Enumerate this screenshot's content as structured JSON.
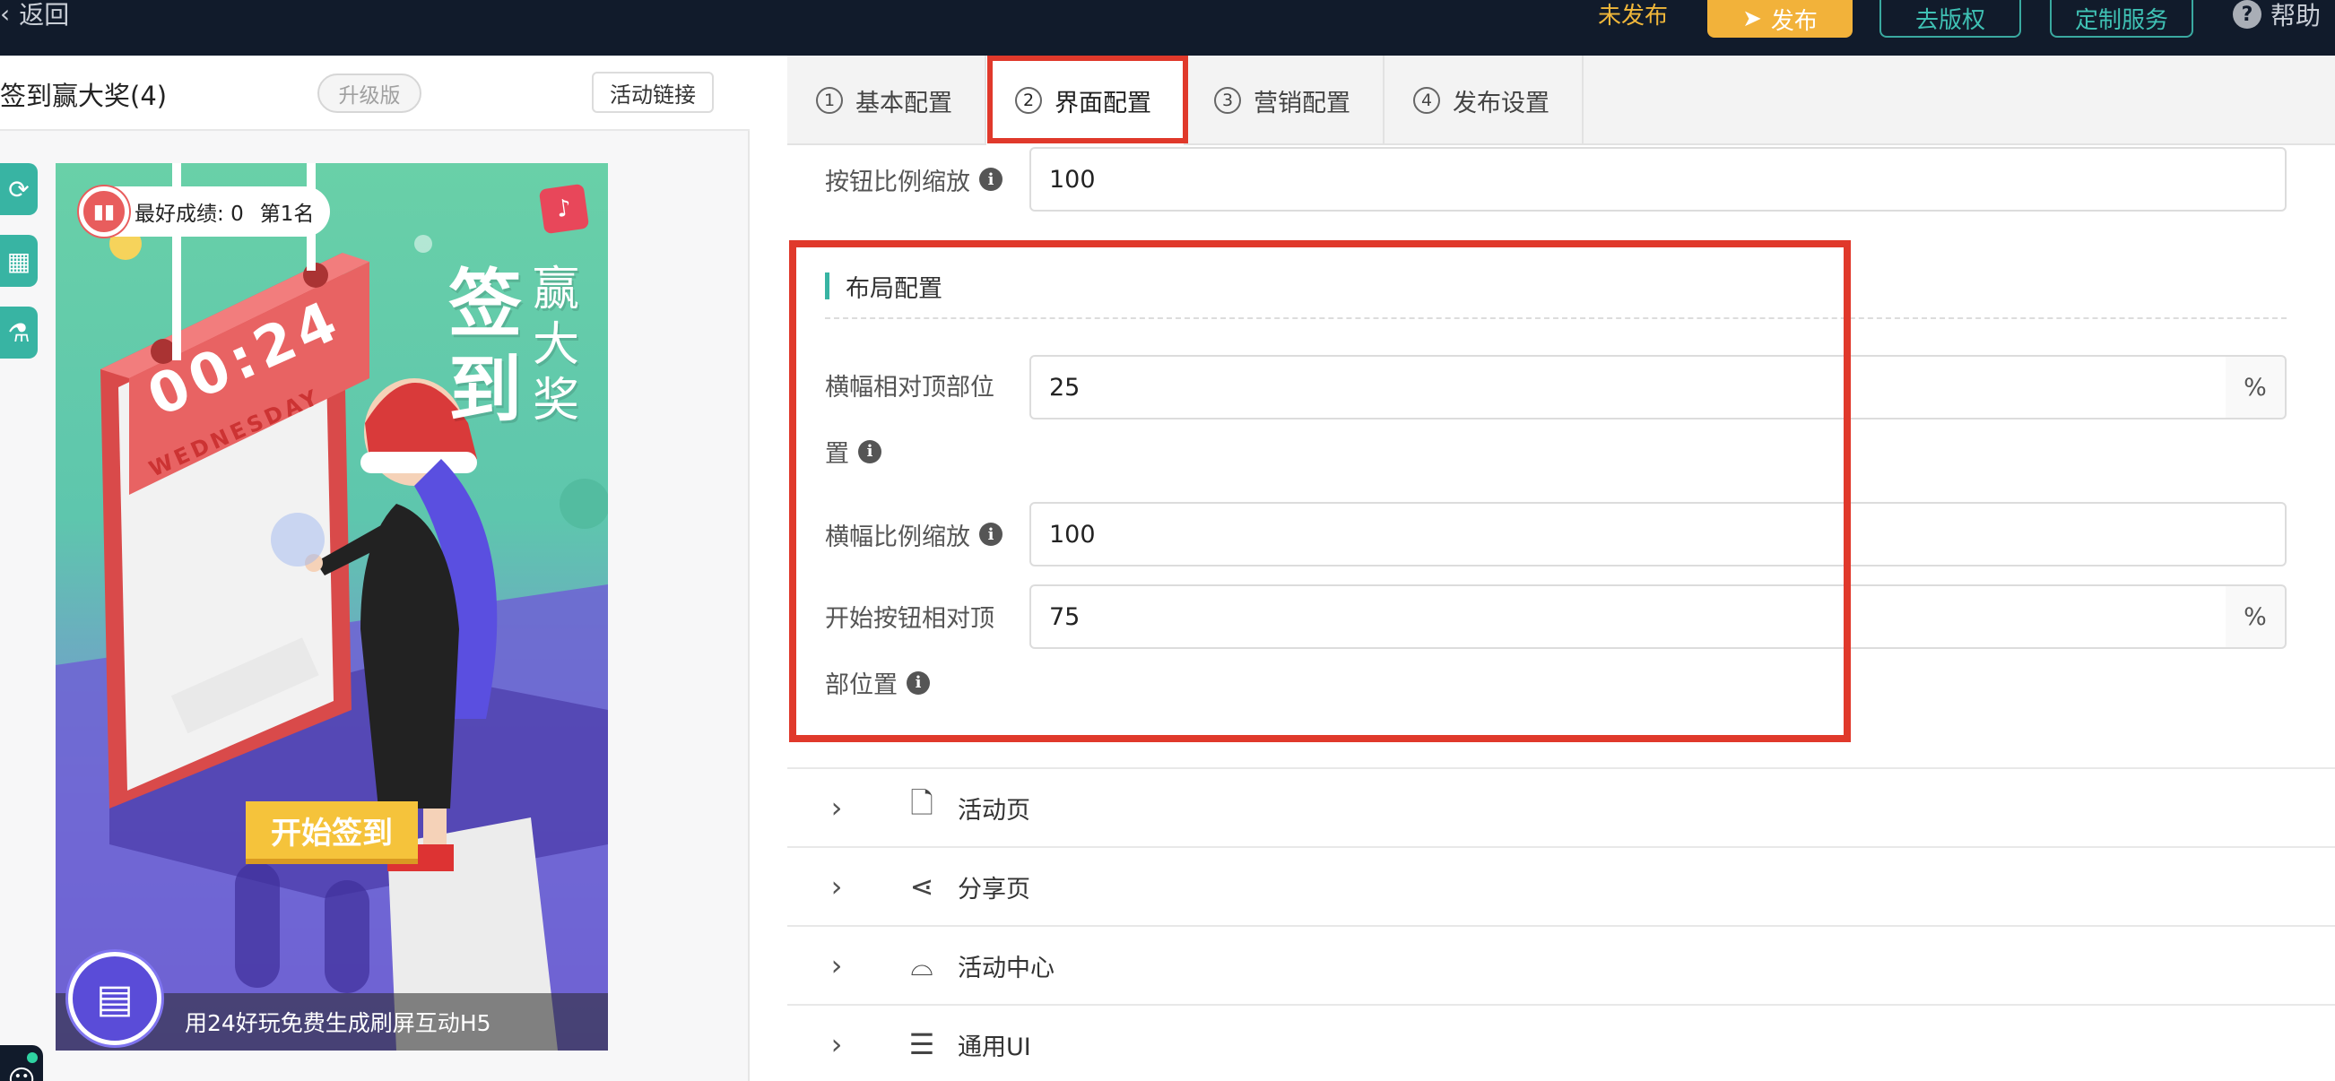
{
  "topbar": {
    "back_label": "返回",
    "status": "未发布",
    "publish_label": "发布",
    "license_label": "去版权",
    "custom_service_label": "定制服务",
    "help_label": "帮助"
  },
  "left_panel": {
    "activity_title": "签到赢大奖(4)",
    "badge": "升级版",
    "link_button": "活动链接"
  },
  "preview": {
    "score_label": "最好成绩:",
    "score_value": "0",
    "rank": "第1名",
    "title_big": "签到",
    "title_small": "赢大奖",
    "clock_time": "00:24",
    "clock_day": "WEDNESDAY",
    "start_button": "开始签到",
    "footer_text": "用24好玩免费生成刷屏互动H5"
  },
  "tabs": [
    {
      "num": "1",
      "label": "基本配置"
    },
    {
      "num": "2",
      "label": "界面配置"
    },
    {
      "num": "3",
      "label": "营销配置"
    },
    {
      "num": "4",
      "label": "发布设置"
    }
  ],
  "form": {
    "button_scale_label": "按钮比例缩放",
    "button_scale_value": "100",
    "section_title": "布局配置",
    "banner_top_label_1": "横幅相对顶部位",
    "banner_top_label_2": "置",
    "banner_top_value": "25",
    "banner_top_unit": "%",
    "banner_scale_label": "横幅比例缩放",
    "banner_scale_value": "100",
    "start_top_label_1": "开始按钮相对顶",
    "start_top_label_2": "部位置",
    "start_top_value": "75",
    "start_top_unit": "%"
  },
  "accordion": [
    {
      "label": "活动页",
      "icon": "page-icon"
    },
    {
      "label": "分享页",
      "icon": "share-icon"
    },
    {
      "label": "活动中心",
      "icon": "whistle-icon"
    },
    {
      "label": "通用UI",
      "icon": "sliders-icon"
    }
  ],
  "colors": {
    "topbar_bg": "#111b2b",
    "accent_teal": "#38b4a3",
    "publish_yellow": "#f2b23a",
    "highlight_red": "#e0392b"
  }
}
